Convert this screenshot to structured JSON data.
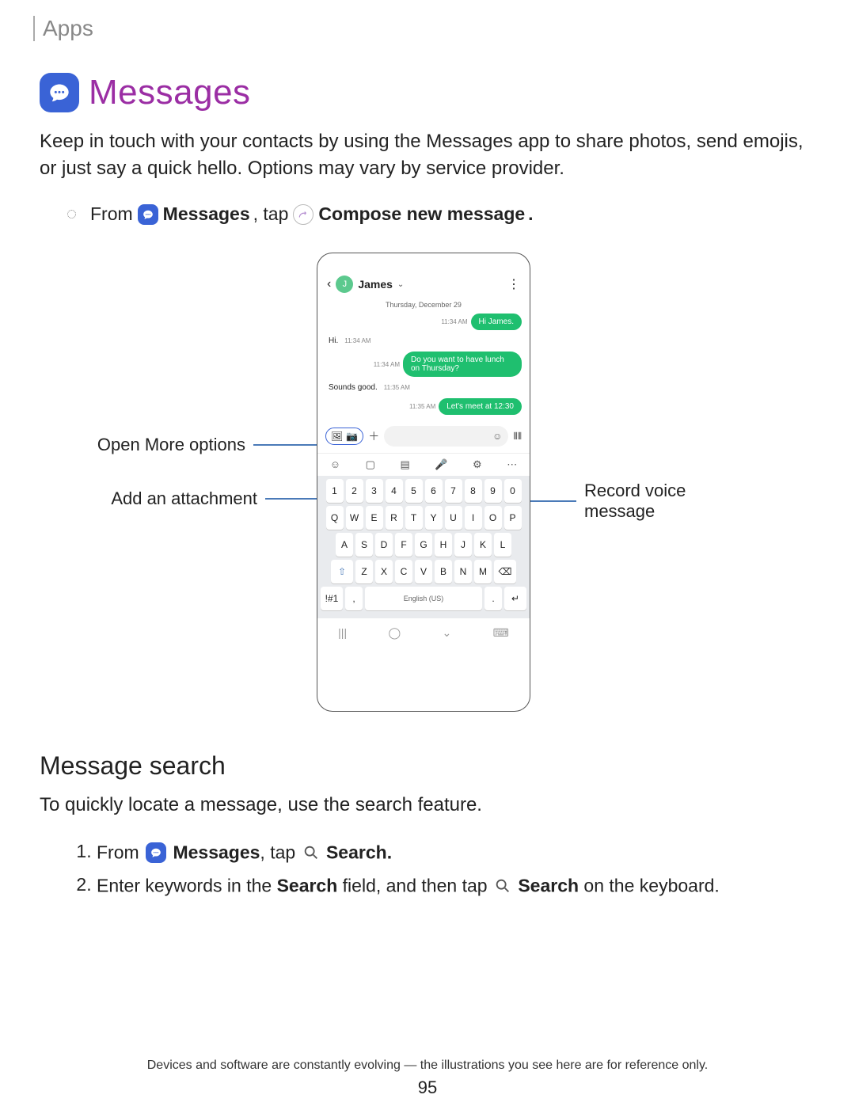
{
  "section": "Apps",
  "title": "Messages",
  "intro": "Keep in touch with your contacts by using the Messages app to share photos, send emojis, or just say a quick hello. Options may vary by service provider.",
  "step_from": "From",
  "step_messages": "Messages",
  "step_tap": ", tap",
  "step_compose": "Compose new message",
  "callouts": {
    "open_more": "Open More options",
    "add_attach": "Add an attachment",
    "record_voice": "Record voice message"
  },
  "phone": {
    "contact": "James",
    "date": "Thursday, December 29",
    "msgs": {
      "m1": "Hi James.",
      "m1t": "11:34 AM",
      "m2": "Hi.",
      "m2t": "11:34 AM",
      "m3": "Do you want to have lunch on Thursday?",
      "m3t": "11:34 AM",
      "m4": "Sounds good.",
      "m4t": "11:35 AM",
      "m5": "Let's meet at 12:30",
      "m5t": "11:35 AM"
    },
    "keyboard": {
      "lang": "English (US)",
      "symkey": "!#1"
    }
  },
  "search": {
    "heading": "Message search",
    "desc": "To quickly locate a message, use the search feature.",
    "step1_from": "From",
    "step1_msgs": "Messages",
    "step1_tap": ", tap",
    "step1_search": "Search",
    "step2a": "Enter keywords in the ",
    "step2b": "Search",
    "step2c": " field, and then tap ",
    "step2d": "Search",
    "step2e": " on the keyboard."
  },
  "footer": "Devices and software are constantly evolving — the illustrations you see here are for reference only.",
  "page": "95"
}
